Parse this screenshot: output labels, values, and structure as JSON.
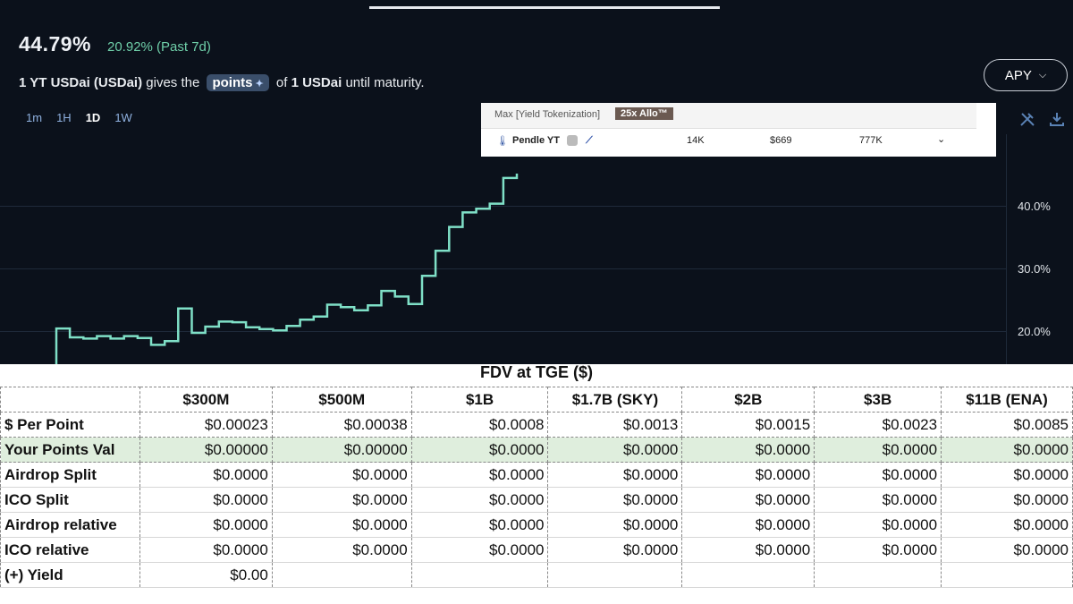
{
  "header": {
    "apy_value": "44.79%",
    "apy_change": "20.92% (Past 7d)",
    "desc_prefix": "1 YT USDai (USDai)",
    "desc_mid": "gives the",
    "points_label": "points",
    "points_icon": "sparkle-icon",
    "desc_of": "of",
    "desc_asset": "1 USDai",
    "desc_suffix": "until maturity.",
    "metric_button": "APY",
    "ranges": [
      "1m",
      "1H",
      "1D",
      "1W"
    ],
    "active_range": "1D"
  },
  "overlay": {
    "header_text": "Max [Yield Tokenization]",
    "badge": "25x Allo™",
    "row": {
      "name": "Pendle YT",
      "col1": "14K",
      "col2": "$669",
      "col3": "777K"
    }
  },
  "chart_data": {
    "type": "line",
    "y_ticks": [
      "40.0%",
      "30.0%",
      "20.0%"
    ],
    "y_values": [
      20.1,
      18.7,
      18.5,
      18.9,
      18.5,
      18.9,
      18.6,
      17.5,
      18.1,
      23.3,
      19.4,
      20.4,
      21.2,
      21.1,
      20.3,
      20.0,
      19.8,
      20.5,
      21.5,
      22.0,
      23.9,
      23.5,
      23.0,
      23.8,
      26.1,
      25.2,
      24.0,
      28.5,
      32.5,
      36.3,
      38.6,
      39.2,
      40.0,
      44.1,
      44.8
    ],
    "ylim": [
      14.7,
      49.5
    ]
  },
  "table": {
    "caption": "FDV at TGE ($)",
    "columns": [
      "$300M",
      "$500M",
      "$1B",
      "$1.7B (SKY)",
      "$2B",
      "$3B",
      "$11B (ENA)"
    ],
    "rows": [
      {
        "label": "$ Per Point",
        "values": [
          "$0.00023",
          "$0.00038",
          "$0.0008",
          "$0.0013",
          "$0.0015",
          "$0.0023",
          "$0.0085"
        ]
      },
      {
        "label": "Your Points Val",
        "values": [
          "$0.00000",
          "$0.00000",
          "$0.0000",
          "$0.0000",
          "$0.0000",
          "$0.0000",
          "$0.0000"
        ]
      },
      {
        "label": "Airdrop Split",
        "values": [
          "$0.0000",
          "$0.0000",
          "$0.0000",
          "$0.0000",
          "$0.0000",
          "$0.0000",
          "$0.0000"
        ]
      },
      {
        "label": "ICO Split",
        "values": [
          "$0.0000",
          "$0.0000",
          "$0.0000",
          "$0.0000",
          "$0.0000",
          "$0.0000",
          "$0.0000"
        ]
      },
      {
        "label": "Airdrop relative",
        "values": [
          "$0.0000",
          "$0.0000",
          "$0.0000",
          "$0.0000",
          "$0.0000",
          "$0.0000",
          "$0.0000"
        ]
      },
      {
        "label": "ICO relative",
        "values": [
          "$0.0000",
          "$0.0000",
          "$0.0000",
          "$0.0000",
          "$0.0000",
          "$0.0000",
          "$0.0000"
        ]
      },
      {
        "label": "(+) Yield",
        "values": [
          "$0.00",
          "",
          "",
          "",
          "",
          "",
          ""
        ]
      }
    ]
  },
  "colors": {
    "chart_line": "#7fe0c7",
    "background": "#0b111b",
    "accent": "#6fcfa9",
    "highlight_row": "#dfeedd"
  }
}
